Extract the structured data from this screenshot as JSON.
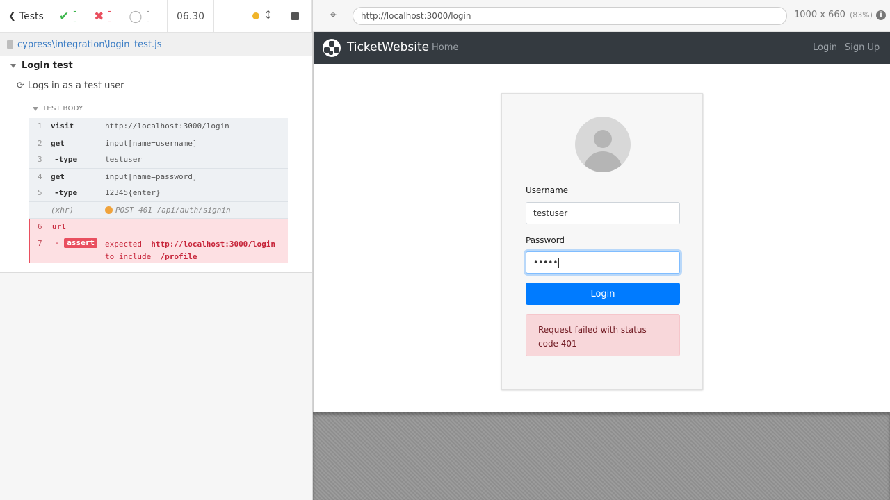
{
  "reporter": {
    "tests_label": "Tests",
    "stats": {
      "passed": "--",
      "failed": "--",
      "pending": "--"
    },
    "duration": "06.30",
    "spec_file": "cypress\\integration\\login_test.js",
    "suite_title": "Login test",
    "test_title": "Logs in as a test user",
    "test_body_label": "TEST BODY",
    "commands": [
      {
        "num": "1",
        "name": "visit",
        "message": "http://localhost:3000/login"
      },
      {
        "num": "2",
        "name": "get",
        "message": "input[name=username]"
      },
      {
        "num": "3",
        "name": "-type",
        "message": "testuser"
      },
      {
        "num": "4",
        "name": "get",
        "message": "input[name=password]"
      },
      {
        "num": "5",
        "name": "-type",
        "message": "12345{enter}"
      },
      {
        "num": "",
        "name": "(xhr)",
        "message": "POST 401 /api/auth/signin"
      },
      {
        "num": "6",
        "name": "url",
        "message": ""
      }
    ],
    "assertion": {
      "num": "7",
      "prefix": "-",
      "badge": "assert",
      "w_expected": "expected",
      "actual": "http://localhost:3000/login",
      "w_to_include": "to include",
      "expected": "/profile"
    }
  },
  "aut": {
    "url": "http://localhost:3000/login",
    "viewport": "1000 x 660",
    "scale": "(83%)",
    "info_icon": "i"
  },
  "app": {
    "brand": "TicketWebsite",
    "nav": {
      "home": "Home",
      "login": "Login",
      "signup": "Sign Up"
    },
    "form": {
      "username_label": "Username",
      "username_value": "testuser",
      "password_label": "Password",
      "password_mask": "•••••",
      "login_button": "Login",
      "error": "Request failed with status code 401"
    }
  },
  "colors": {
    "pass": "#3ab54a",
    "fail": "#e94f5f",
    "navbar": "#343a40",
    "primary": "#007bff",
    "alert_bg": "#f8d7da"
  },
  "icons": {
    "back": "chevron-left-icon",
    "passed": "check-icon",
    "failed": "x-icon",
    "pending": "circle-notch-icon",
    "running": "status-dot-icon",
    "scroll": "arrows-up-down-icon",
    "stop": "stop-icon",
    "selector": "crosshair-icon",
    "logo": "soccer-ball-icon"
  }
}
